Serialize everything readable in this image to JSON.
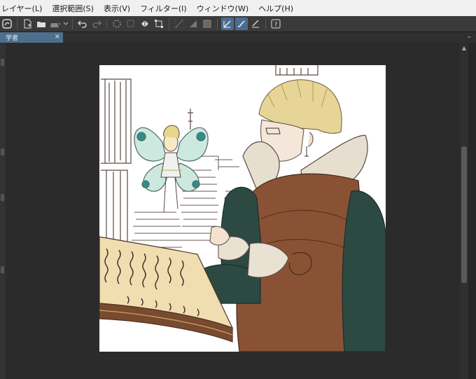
{
  "menu": {
    "items": [
      {
        "label": "レイヤー(L)"
      },
      {
        "label": "選択範囲(S)"
      },
      {
        "label": "表示(V)"
      },
      {
        "label": "フィルター(I)"
      },
      {
        "label": "ウィンドウ(W)"
      },
      {
        "label": "ヘルプ(H)"
      }
    ]
  },
  "toolbar": {
    "icons": [
      "app-logo-icon",
      "new-file-icon",
      "open-folder-icon",
      "save-icon",
      "undo-icon",
      "redo-icon",
      "loading-icon",
      "clear-selection-icon",
      "fill-icon",
      "transform-icon",
      "snap-ruler-icon",
      "snap-grid-icon",
      "snap-special-ruler-icon",
      "pen-pressure-icon",
      "brush-stroke-icon",
      "ruler-pen-icon",
      "help-icon"
    ]
  },
  "tab": {
    "title": "学者",
    "close": "×"
  },
  "colors": {
    "menu_bg": "#f0f0f0",
    "toolbar_bg": "#3a3a3a",
    "tab_active": "#4d6f8c",
    "workspace_bg": "#2b2b2b",
    "canvas_bg": "#ffffff",
    "active_tool": "#4b6d93"
  }
}
